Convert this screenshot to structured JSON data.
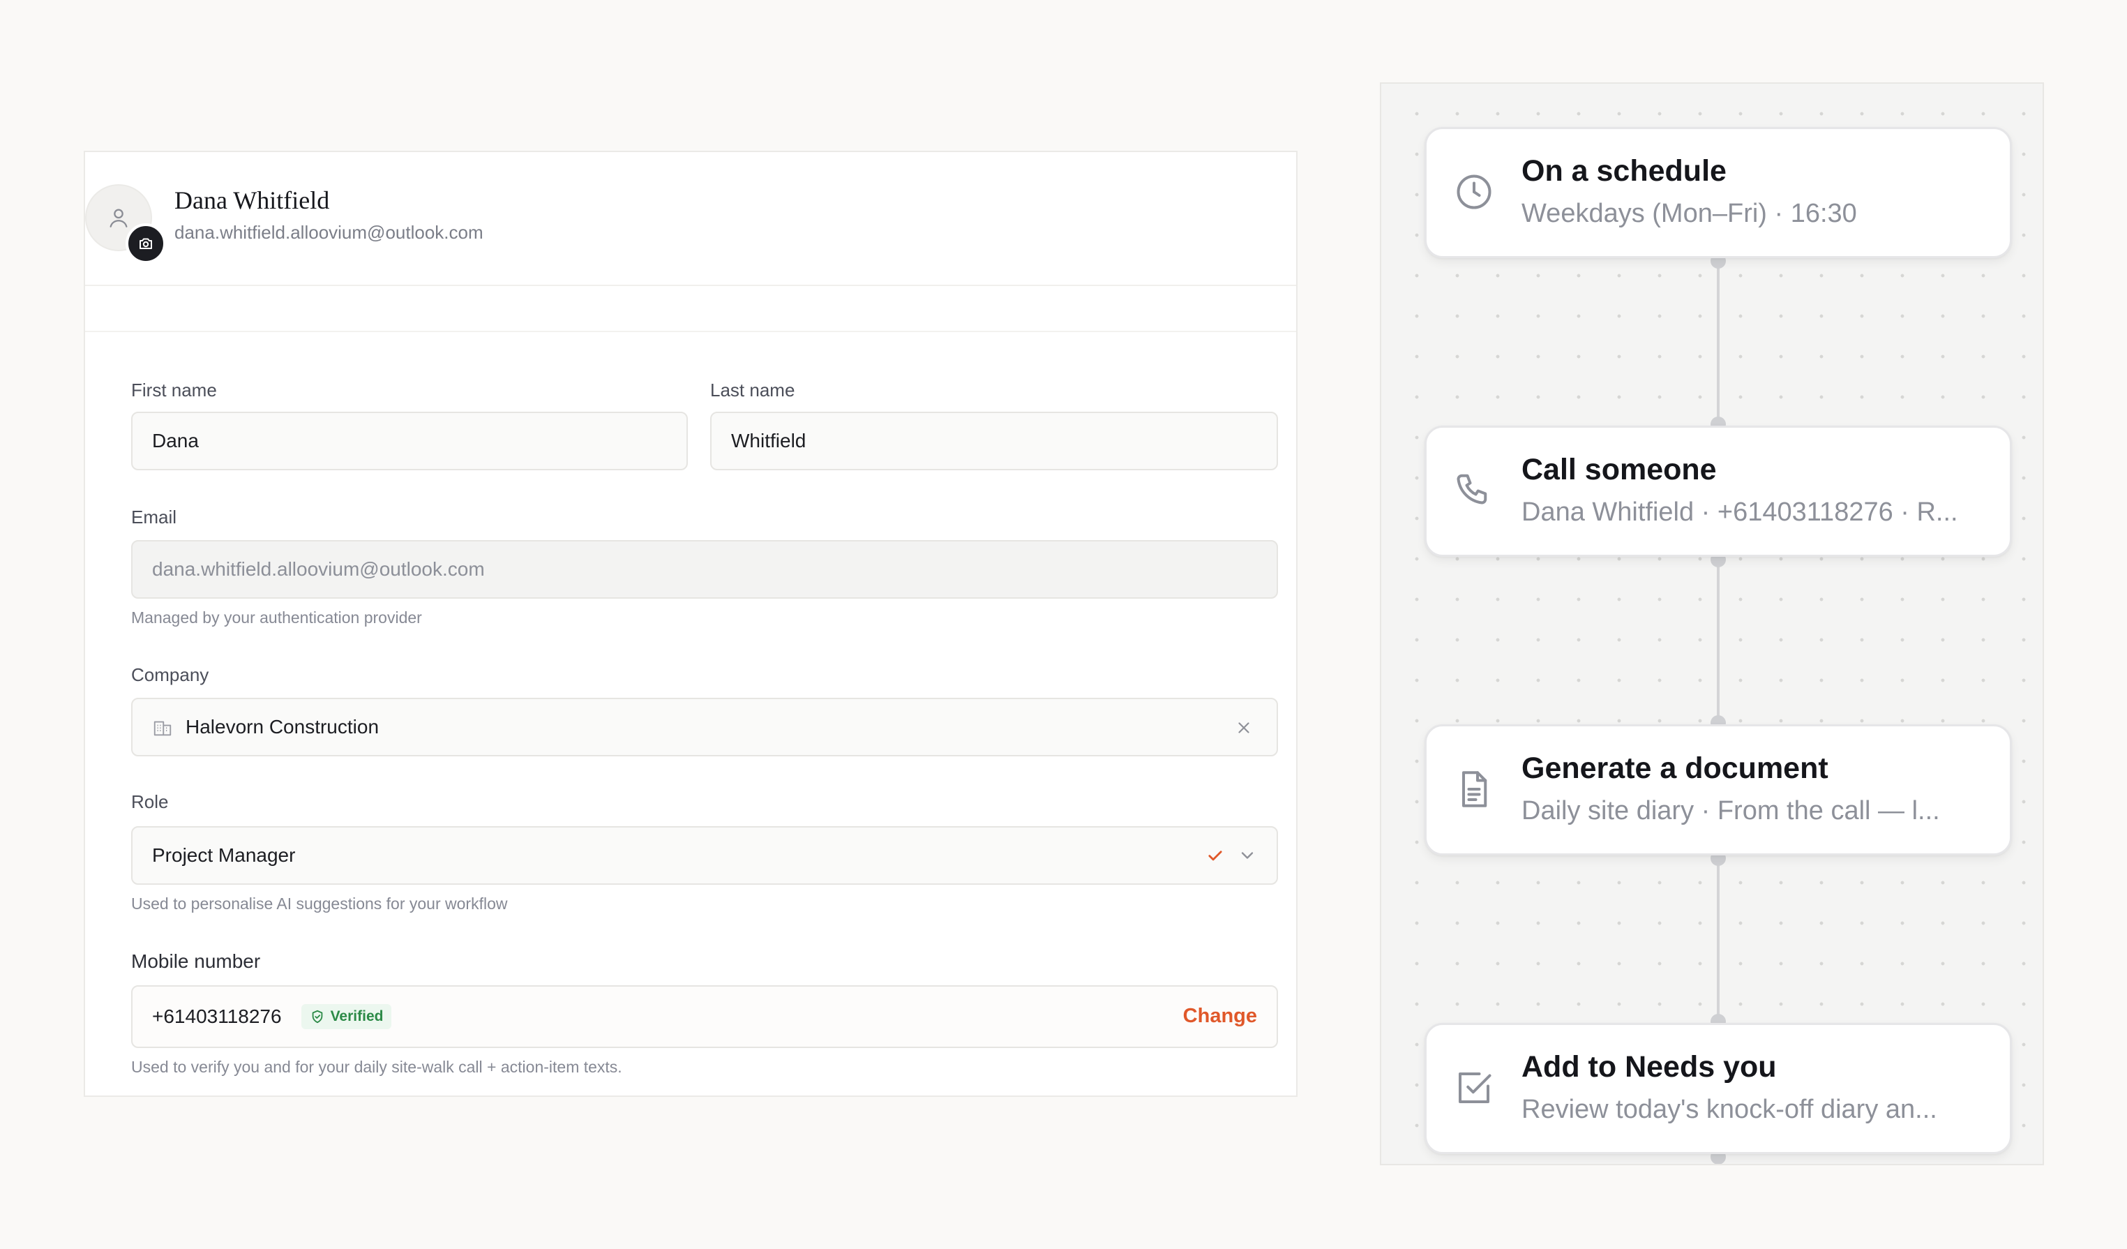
{
  "profile": {
    "name": "Dana Whitfield",
    "email": "dana.whitfield.alloovium@outlook.com",
    "icons": {
      "avatar": "user-icon",
      "badge": "camera-icon"
    }
  },
  "form": {
    "first_name": {
      "label": "First name",
      "value": "Dana"
    },
    "last_name": {
      "label": "Last name",
      "value": "Whitfield"
    },
    "email": {
      "label": "Email",
      "value": "dana.whitfield.alloovium@outlook.com",
      "helper": "Managed by your authentication provider"
    },
    "company": {
      "label": "Company",
      "value": "Halevorn Construction",
      "icon": "building-icon",
      "clear_icon": "close-icon"
    },
    "role": {
      "label": "Role",
      "value": "Project Manager",
      "helper": "Used to personalise AI suggestions for your workflow",
      "icons": [
        "check-icon",
        "chevron-down-icon"
      ]
    },
    "mobile": {
      "label": "Mobile number",
      "value": "+61403118276",
      "badge": "Verified",
      "action": "Change",
      "helper": "Used to verify you and for your daily site-walk call + action-item texts."
    }
  },
  "workflow": {
    "steps": [
      {
        "title": "On a schedule",
        "subtitle": "Weekdays (Mon–Fri) · 16:30",
        "icon": "clock-icon"
      },
      {
        "title": "Call someone",
        "subtitle": "Dana Whitfield · +61403118276 · R...",
        "icon": "phone-icon"
      },
      {
        "title": "Generate a document",
        "subtitle": "Daily site diary · From the call — l...",
        "icon": "document-icon"
      },
      {
        "title": "Add to Needs you",
        "subtitle": "Review today's knock-off diary an...",
        "icon": "checkbox-icon"
      }
    ]
  },
  "colors": {
    "accent": "#e0582a",
    "verified_text": "#2c8a47",
    "verified_bg": "#ecf7ef",
    "check": "#e0582a"
  }
}
